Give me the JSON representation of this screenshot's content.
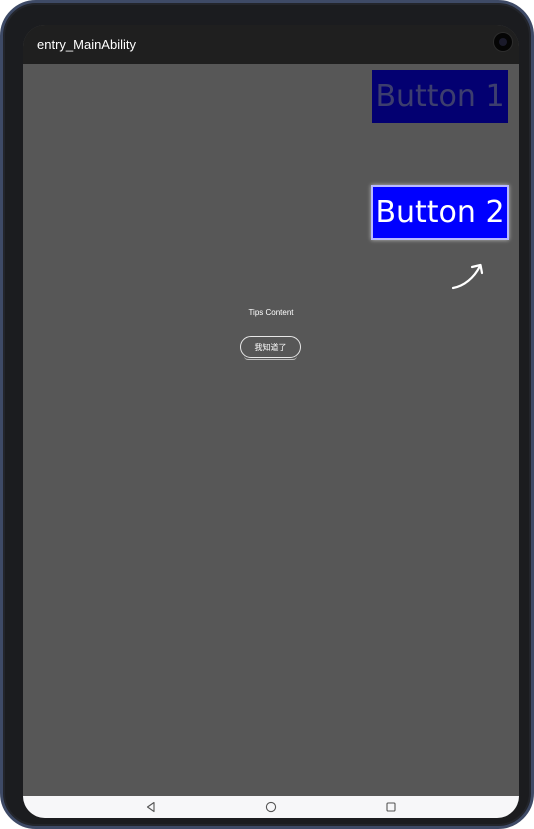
{
  "window": {
    "title": "entry_MainAbility"
  },
  "buttons": {
    "button1_label": "Button 1",
    "button2_label": "Button 2"
  },
  "tips": {
    "content": "Tips Content",
    "confirm_label": "我知道了"
  },
  "colors": {
    "button1_bg": "#030071",
    "button2_bg": "#0000ff",
    "content_bg": "#575757"
  },
  "icons": {
    "arrow": "curved-arrow-icon",
    "back": "back-triangle-icon",
    "home": "home-circle-icon",
    "recent": "recent-square-icon"
  }
}
